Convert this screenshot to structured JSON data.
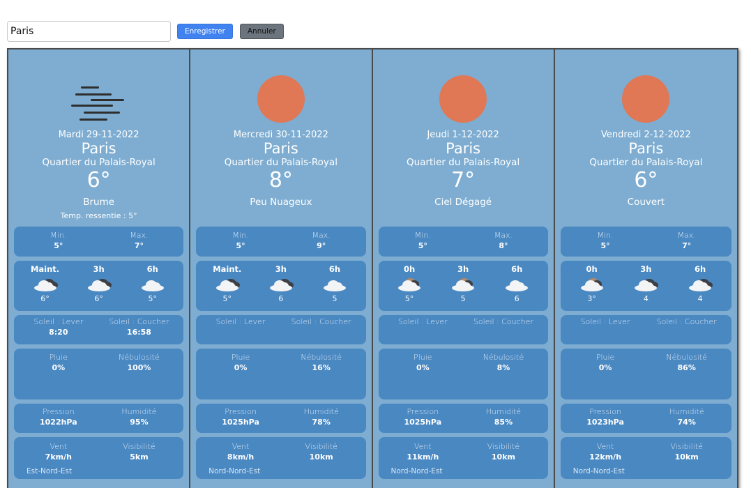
{
  "search": {
    "value": "Paris",
    "placeholder": ""
  },
  "buttons": {
    "save": "Enregistrer",
    "cancel": "Annuler"
  },
  "labels": {
    "min": "Min.",
    "max": "Max.",
    "sunrise": "Soleil : Lever",
    "sunset": "Soleil : Coucher",
    "rain": "Pluie",
    "cloud": "Nébulosité",
    "pressure": "Pression",
    "humidity": "Humidité",
    "wind": "Vent",
    "visibility": "Visibilité"
  },
  "colors": {
    "card_bg": "#7eadd1",
    "box_bg": "#4a88c2",
    "sun": "#e07755",
    "save_button": "#3f82f0",
    "cancel_button": "#6c757d"
  },
  "days": [
    {
      "icon": "mist-icon",
      "date": "Mardi 29-11-2022",
      "city": "Paris",
      "district": "Quartier du Palais-Royal",
      "temp": "6°",
      "condition": "Brume",
      "feels": "Temp. ressentie : 5°",
      "min": "5°",
      "max": "7°",
      "hours": [
        {
          "label": "Maint.",
          "icon": "dark-cloud-icon",
          "temp": "6°"
        },
        {
          "label": "3h",
          "icon": "dark-cloud-icon",
          "temp": "6°"
        },
        {
          "label": "6h",
          "icon": "cloud-icon",
          "temp": "5°"
        }
      ],
      "sunrise": "8:20",
      "sunset": "16:58",
      "rain": "0%",
      "cloud": "100%",
      "pressure": "1022hPa",
      "humidity": "95%",
      "wind": "7km/h",
      "visibility": "5km",
      "wind_dir": "Est-Nord-Est"
    },
    {
      "icon": "sun-icon",
      "date": "Mercredi 30-11-2022",
      "city": "Paris",
      "district": "Quartier du Palais-Royal",
      "temp": "8°",
      "condition": "Peu Nuageux",
      "feels": "",
      "min": "5°",
      "max": "9°",
      "hours": [
        {
          "label": "Maint.",
          "icon": "dark-cloud-icon",
          "temp": "5°"
        },
        {
          "label": "3h",
          "icon": "dark-cloud-icon",
          "temp": "6"
        },
        {
          "label": "6h",
          "icon": "cloud-icon",
          "temp": "5"
        }
      ],
      "sunrise": "",
      "sunset": "",
      "rain": "0%",
      "cloud": "16%",
      "pressure": "1025hPa",
      "humidity": "78%",
      "wind": "8km/h",
      "visibility": "10km",
      "wind_dir": "Nord-Nord-Est"
    },
    {
      "icon": "sun-icon",
      "date": "Jeudi 1-12-2022",
      "city": "Paris",
      "district": "Quartier du Palais-Royal",
      "temp": "7°",
      "condition": "Ciel Dégagé",
      "feels": "",
      "min": "5°",
      "max": "8°",
      "hours": [
        {
          "label": "0h",
          "icon": "moon-cloud-icon",
          "temp": "5°"
        },
        {
          "label": "3h",
          "icon": "moon-cloud-icon",
          "temp": "5"
        },
        {
          "label": "6h",
          "icon": "cloud-icon",
          "temp": "6"
        }
      ],
      "sunrise": "",
      "sunset": "",
      "rain": "0%",
      "cloud": "8%",
      "pressure": "1025hPa",
      "humidity": "85%",
      "wind": "11km/h",
      "visibility": "10km",
      "wind_dir": "Nord-Nord-Est"
    },
    {
      "icon": "sun-icon",
      "date": "Vendredi 2-12-2022",
      "city": "Paris",
      "district": "Quartier du Palais-Royal",
      "temp": "6°",
      "condition": "Couvert",
      "feels": "",
      "min": "5°",
      "max": "7°",
      "hours": [
        {
          "label": "0h",
          "icon": "moon-cloud-icon",
          "temp": "3°"
        },
        {
          "label": "3h",
          "icon": "dark-cloud-icon",
          "temp": "4"
        },
        {
          "label": "6h",
          "icon": "dark-cloud-icon",
          "temp": "4"
        }
      ],
      "sunrise": "",
      "sunset": "",
      "rain": "0%",
      "cloud": "86%",
      "pressure": "1023hPa",
      "humidity": "74%",
      "wind": "12km/h",
      "visibility": "10km",
      "wind_dir": "Nord-Nord-Est"
    }
  ]
}
